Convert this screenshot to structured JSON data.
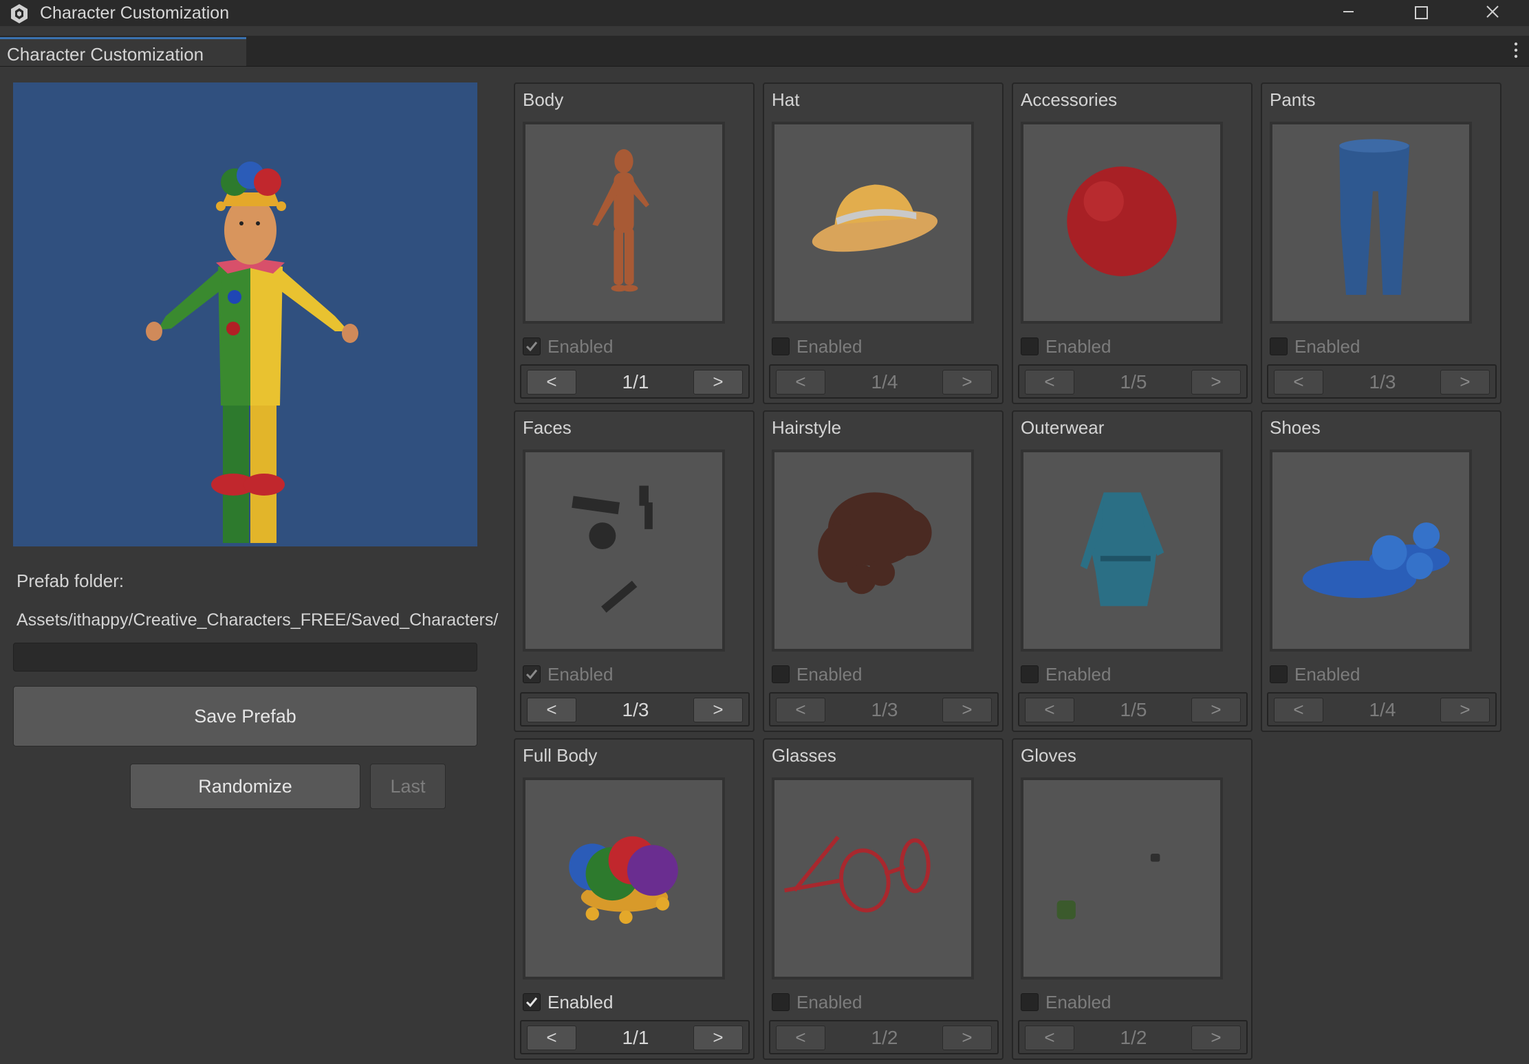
{
  "window": {
    "title": "Character Customization"
  },
  "tab": {
    "label": "Character Customization"
  },
  "left": {
    "prefab_folder_label": "Prefab folder:",
    "prefab_path": "Assets/ithappy/Creative_Characters_FREE/Saved_Characters/",
    "name_input_value": "",
    "save_label": "Save Prefab",
    "randomize_label": "Randomize",
    "last_label": "Last"
  },
  "slots": [
    {
      "title": "Body",
      "enabled_label": "Enabled",
      "checked": true,
      "counter": "1/1",
      "prev": "<",
      "next": ">"
    },
    {
      "title": "Hat",
      "enabled_label": "Enabled",
      "checked": false,
      "counter": "1/4",
      "prev": "<",
      "next": ">"
    },
    {
      "title": "Accessories",
      "enabled_label": "Enabled",
      "checked": false,
      "counter": "1/5",
      "prev": "<",
      "next": ">"
    },
    {
      "title": "Pants",
      "enabled_label": "Enabled",
      "checked": false,
      "counter": "1/3",
      "prev": "<",
      "next": ">"
    },
    {
      "title": "Faces",
      "enabled_label": "Enabled",
      "checked": true,
      "counter": "1/3",
      "prev": "<",
      "next": ">"
    },
    {
      "title": "Hairstyle",
      "enabled_label": "Enabled",
      "checked": false,
      "counter": "1/3",
      "prev": "<",
      "next": ">"
    },
    {
      "title": "Outerwear",
      "enabled_label": "Enabled",
      "checked": false,
      "counter": "1/5",
      "prev": "<",
      "next": ">"
    },
    {
      "title": "Shoes",
      "enabled_label": "Enabled",
      "checked": false,
      "counter": "1/4",
      "prev": "<",
      "next": ">"
    },
    {
      "title": "Full Body",
      "enabled_label": "Enabled",
      "checked": true,
      "counter": "1/1",
      "prev": "<",
      "next": ">"
    },
    {
      "title": "Glasses",
      "enabled_label": "Enabled",
      "checked": false,
      "counter": "1/2",
      "prev": "<",
      "next": ">"
    },
    {
      "title": "Gloves",
      "enabled_label": "Enabled",
      "checked": false,
      "counter": "1/2",
      "prev": "<",
      "next": ">"
    }
  ],
  "colors": {
    "preview_bg": "#30507f",
    "accent": "#3a72b0",
    "panel_bg": "#383838"
  }
}
